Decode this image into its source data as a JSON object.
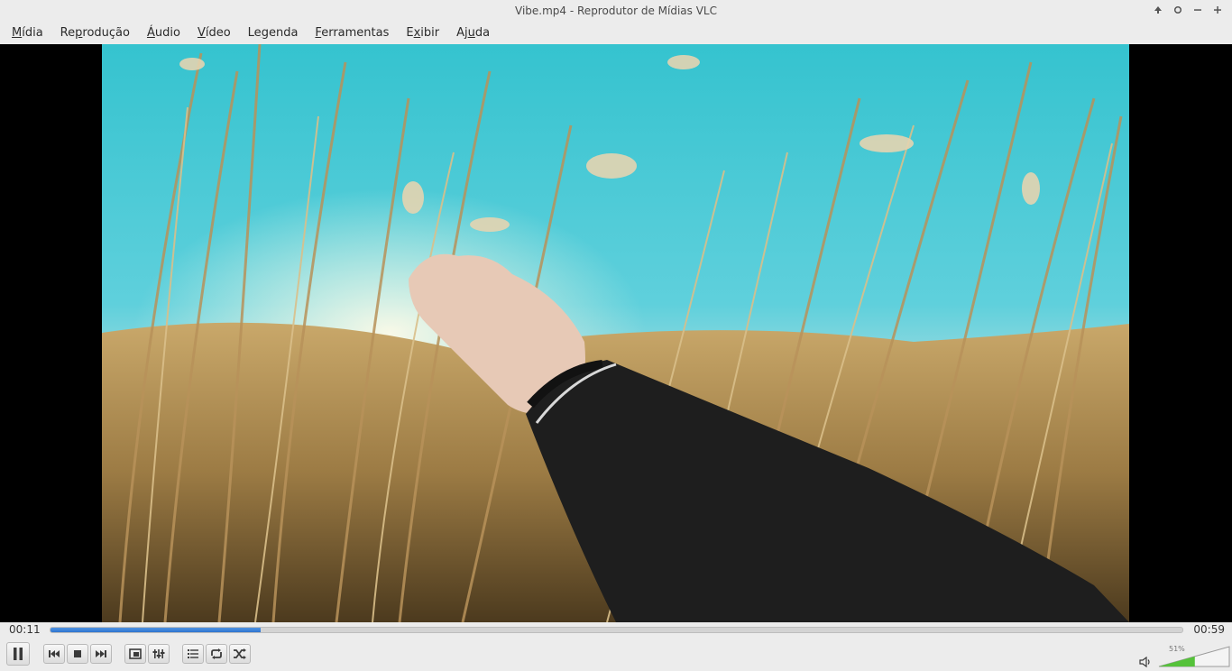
{
  "window": {
    "title": "Vibe.mp4 - Reprodutor de Mídias VLC",
    "controls": [
      "up-arrow-icon",
      "circle-icon",
      "minimize-icon",
      "maximize-icon"
    ]
  },
  "menu": [
    {
      "mnemonic": "M",
      "rest": "ídia"
    },
    {
      "pre": "Re",
      "mnemonic": "p",
      "rest": "rodução"
    },
    {
      "mnemonic": "Á",
      "rest": "udio"
    },
    {
      "mnemonic": "V",
      "rest": "ídeo"
    },
    {
      "pre": "Le",
      "mnemonic": "g",
      "rest": "enda"
    },
    {
      "mnemonic": "F",
      "rest": "erramentas"
    },
    {
      "pre": "E",
      "mnemonic": "x",
      "rest": "ibir"
    },
    {
      "pre": "Aj",
      "mnemonic": "u",
      "rest": "da"
    }
  ],
  "playback": {
    "elapsed": "00:11",
    "total": "00:59",
    "progress": 0.186
  },
  "volume": {
    "label": "51%",
    "level": 0.51
  },
  "colors": {
    "accent": "#3a7fd9",
    "volume_fill": "#55c23a"
  }
}
